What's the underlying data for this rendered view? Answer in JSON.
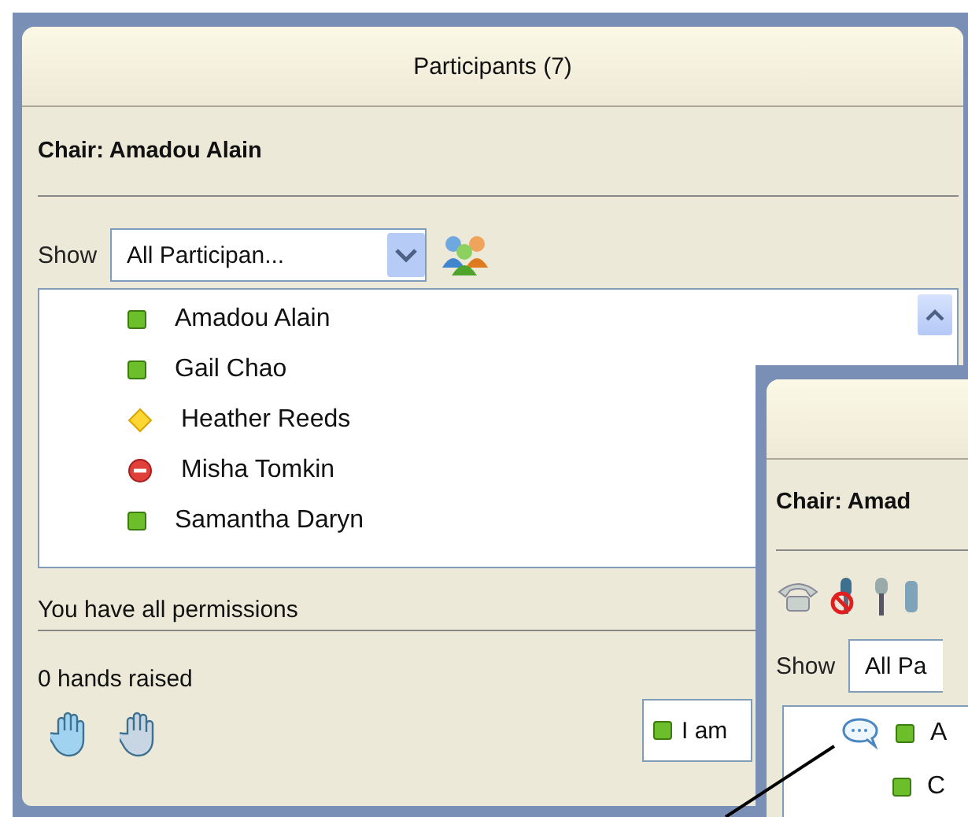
{
  "main_window": {
    "title": "Participants (7)",
    "chair": "Chair: Amadou Alain",
    "show_label": "Show",
    "filter": "All Participan...",
    "participants": [
      {
        "name": "Amadou Alain",
        "kind": "active"
      },
      {
        "name": "Gail Chao",
        "kind": "active"
      },
      {
        "name": "Heather Reeds",
        "kind": "away"
      },
      {
        "name": "Misha Tomkin",
        "kind": "busy"
      },
      {
        "name": "Samantha Daryn",
        "kind": "active"
      }
    ],
    "permissions": "You have all permissions",
    "hands": "0 hands raised",
    "status_field": {
      "text": "I am",
      "kind": "active"
    }
  },
  "second_window": {
    "chair": "Chair: Amad",
    "show_label": "Show",
    "filter": "All Pa",
    "participants": [
      {
        "name": "A",
        "kind": "active",
        "chatting": true
      },
      {
        "name": "C",
        "kind": "active",
        "chatting": false
      }
    ]
  }
}
